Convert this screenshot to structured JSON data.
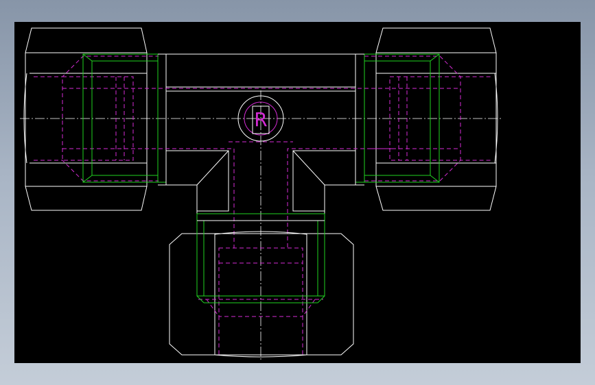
{
  "drawing": {
    "background_color": "#000000",
    "frame_color": "#a9b5c5",
    "line_colors": {
      "visible_edges": "#ffffff",
      "thread_lines": "#21d321",
      "hidden_lines": "#d62cd6",
      "center_lines": "#ffffff"
    },
    "views": [
      "left-nut",
      "right-nut",
      "bottom-nut",
      "tee-body",
      "port-bore",
      "logo-mark"
    ],
    "logo_glyph": "R"
  }
}
